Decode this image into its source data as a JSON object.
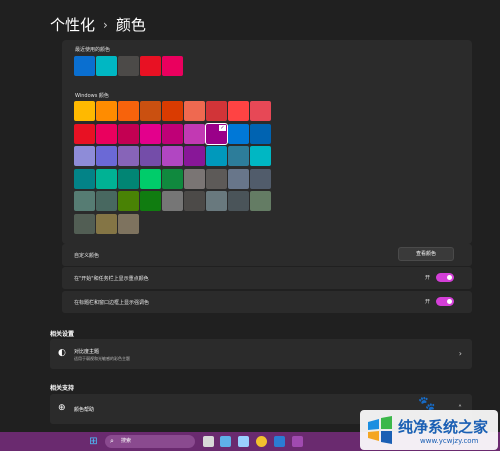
{
  "breadcrumb": {
    "parent": "个性化",
    "separator": "›",
    "current": "颜色"
  },
  "recent_colors": {
    "label": "最近使用的颜色",
    "swatches": [
      "#0a6fd0",
      "#00b7c3",
      "#4c4a48",
      "#e81123",
      "#ea005e"
    ]
  },
  "windows_colors": {
    "label": "Windows 颜色",
    "rows": [
      [
        "#ffb900",
        "#ff8c00",
        "#f7630c",
        "#ca5010",
        "#da3b01",
        "#ef6950",
        "#d13438",
        "#ff4343",
        "#e74856"
      ],
      [
        "#e81123",
        "#ea005e",
        "#c30052",
        "#e3008c",
        "#bf0077",
        "#c239b3",
        "#9a0089",
        "#0078d7",
        "#0063b1"
      ],
      [
        "#8e8cd8",
        "#6b69d6",
        "#8764b8",
        "#744da9",
        "#b146c2",
        "#881798",
        "#0099bc",
        "#2d7d9a",
        "#00b7c3"
      ],
      [
        "#038387",
        "#00b294",
        "#018574",
        "#00cc6a",
        "#10893e",
        "#7a7574",
        "#5d5a58",
        "#68768a",
        "#515c6b"
      ],
      [
        "#567c73",
        "#486860",
        "#498205",
        "#107c10",
        "#767676",
        "#4c4a48",
        "#69797e",
        "#4a5459",
        "#647c64"
      ],
      [
        "#525e54",
        "#847545",
        "#7e735f"
      ]
    ],
    "selected": "#9a0089"
  },
  "custom_color": {
    "label": "自定义颜色",
    "button": "查看颜色"
  },
  "accent_start_taskbar": {
    "label": "在\"开始\"和任务栏上显示重点颜色",
    "state": "开"
  },
  "accent_title_bars": {
    "label": "在标题栏和窗口边框上显示强调色",
    "state": "开"
  },
  "related_settings": {
    "title": "相关设置",
    "contrast_title": "对比度主题",
    "contrast_sub": "适用于弱视和光敏感的彩色主题"
  },
  "related_support": {
    "title": "相关支持",
    "help": "颜色帮助"
  },
  "taskbar": {
    "search_placeholder": "搜索",
    "color": "#6a2a6f"
  },
  "watermark": {
    "name": "纯净系统之家",
    "url": "www.ycwjzy.com"
  }
}
